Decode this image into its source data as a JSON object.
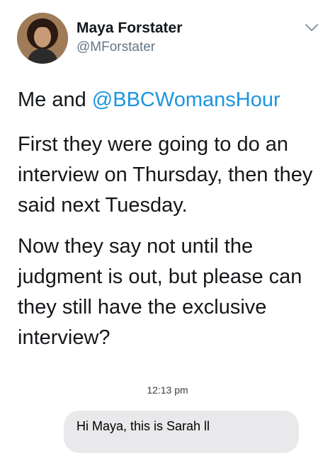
{
  "tweet": {
    "author_name": "Maya Forstater",
    "author_handle": "@MForstater",
    "avatar_icon": "profile-photo",
    "menu_icon": "chevron-down-icon",
    "line1_prefix": "Me and ",
    "line1_mention": "@BBCWomansHour",
    "paragraph2": "First they were going to do an interview on Thursday, then they said next Tuesday.",
    "paragraph3": "Now they say not until the judgment is out, but please can they still have the exclusive interview?"
  },
  "screenshot": {
    "timestamp": "12:13 pm",
    "message_preview": "Hi Maya, this is Sarah ll"
  },
  "colors": {
    "mention": "#1b95e0",
    "handle": "#657786",
    "bubble": "#e9e9eb"
  }
}
